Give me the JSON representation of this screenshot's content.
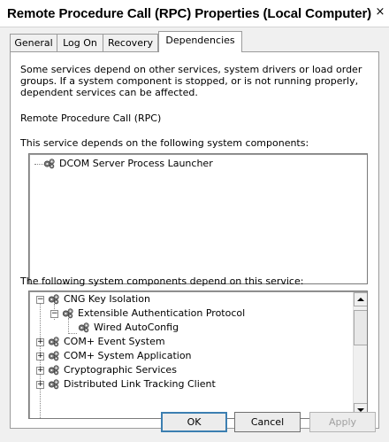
{
  "window": {
    "title": "Remote Procedure Call (RPC) Properties (Local Computer)",
    "close_glyph": "×"
  },
  "tabs": [
    {
      "label": "General",
      "active": false
    },
    {
      "label": "Log On",
      "active": false
    },
    {
      "label": "Recovery",
      "active": false
    },
    {
      "label": "Dependencies",
      "active": true
    }
  ],
  "panel": {
    "description": "Some services depend on other services, system drivers or load order groups. If a system component is stopped, or is not running properly, dependent services can be affected.",
    "service_name": "Remote Procedure Call (RPC)",
    "depends_on_label": "This service depends on the following system components:",
    "depends_on_items": [
      {
        "label": "DCOM Server Process Launcher",
        "icon": "gear-icon"
      }
    ],
    "dependents_label": "The following system components depend on this service:",
    "dependents_items": [
      {
        "label": "CNG Key Isolation",
        "expander": "−",
        "icon": "gear-icon"
      },
      {
        "label": "Extensible Authentication Protocol",
        "expander": "−",
        "icon": "gear-icon"
      },
      {
        "label": "Wired AutoConfig",
        "expander": "",
        "icon": "gear-icon"
      },
      {
        "label": "COM+ Event System",
        "expander": "+",
        "icon": "gear-icon"
      },
      {
        "label": "COM+ System Application",
        "expander": "+",
        "icon": "gear-icon"
      },
      {
        "label": "Cryptographic Services",
        "expander": "+",
        "icon": "gear-icon"
      },
      {
        "label": "Distributed Link Tracking Client",
        "expander": "+",
        "icon": "gear-icon"
      }
    ]
  },
  "buttons": {
    "ok": "OK",
    "cancel": "Cancel",
    "apply": "Apply"
  }
}
